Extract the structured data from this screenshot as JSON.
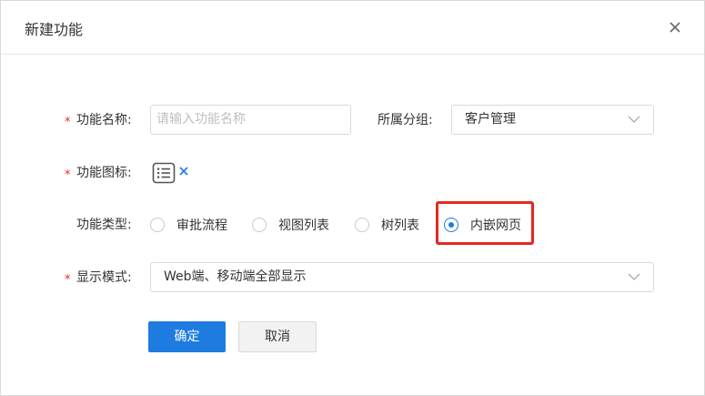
{
  "dialog": {
    "title": "新建功能"
  },
  "form": {
    "name": {
      "label": "功能名称:",
      "placeholder": "请输入功能名称",
      "required": true
    },
    "group": {
      "label": "所属分组:",
      "value": "客户管理"
    },
    "icon": {
      "label": "功能图标:",
      "required": true,
      "icon_name": "list-icon"
    },
    "type": {
      "label": "功能类型:",
      "options": [
        "审批流程",
        "视图列表",
        "树列表",
        "内嵌网页"
      ],
      "selected": "内嵌网页"
    },
    "display": {
      "label": "显示模式:",
      "required": true,
      "value": "Web端、移动端全部显示"
    },
    "required_mark": "*"
  },
  "buttons": {
    "confirm": "确定",
    "cancel": "取消"
  },
  "colors": {
    "primary": "#1e7be0",
    "required": "#f5222d",
    "highlight": "#e5281f"
  }
}
